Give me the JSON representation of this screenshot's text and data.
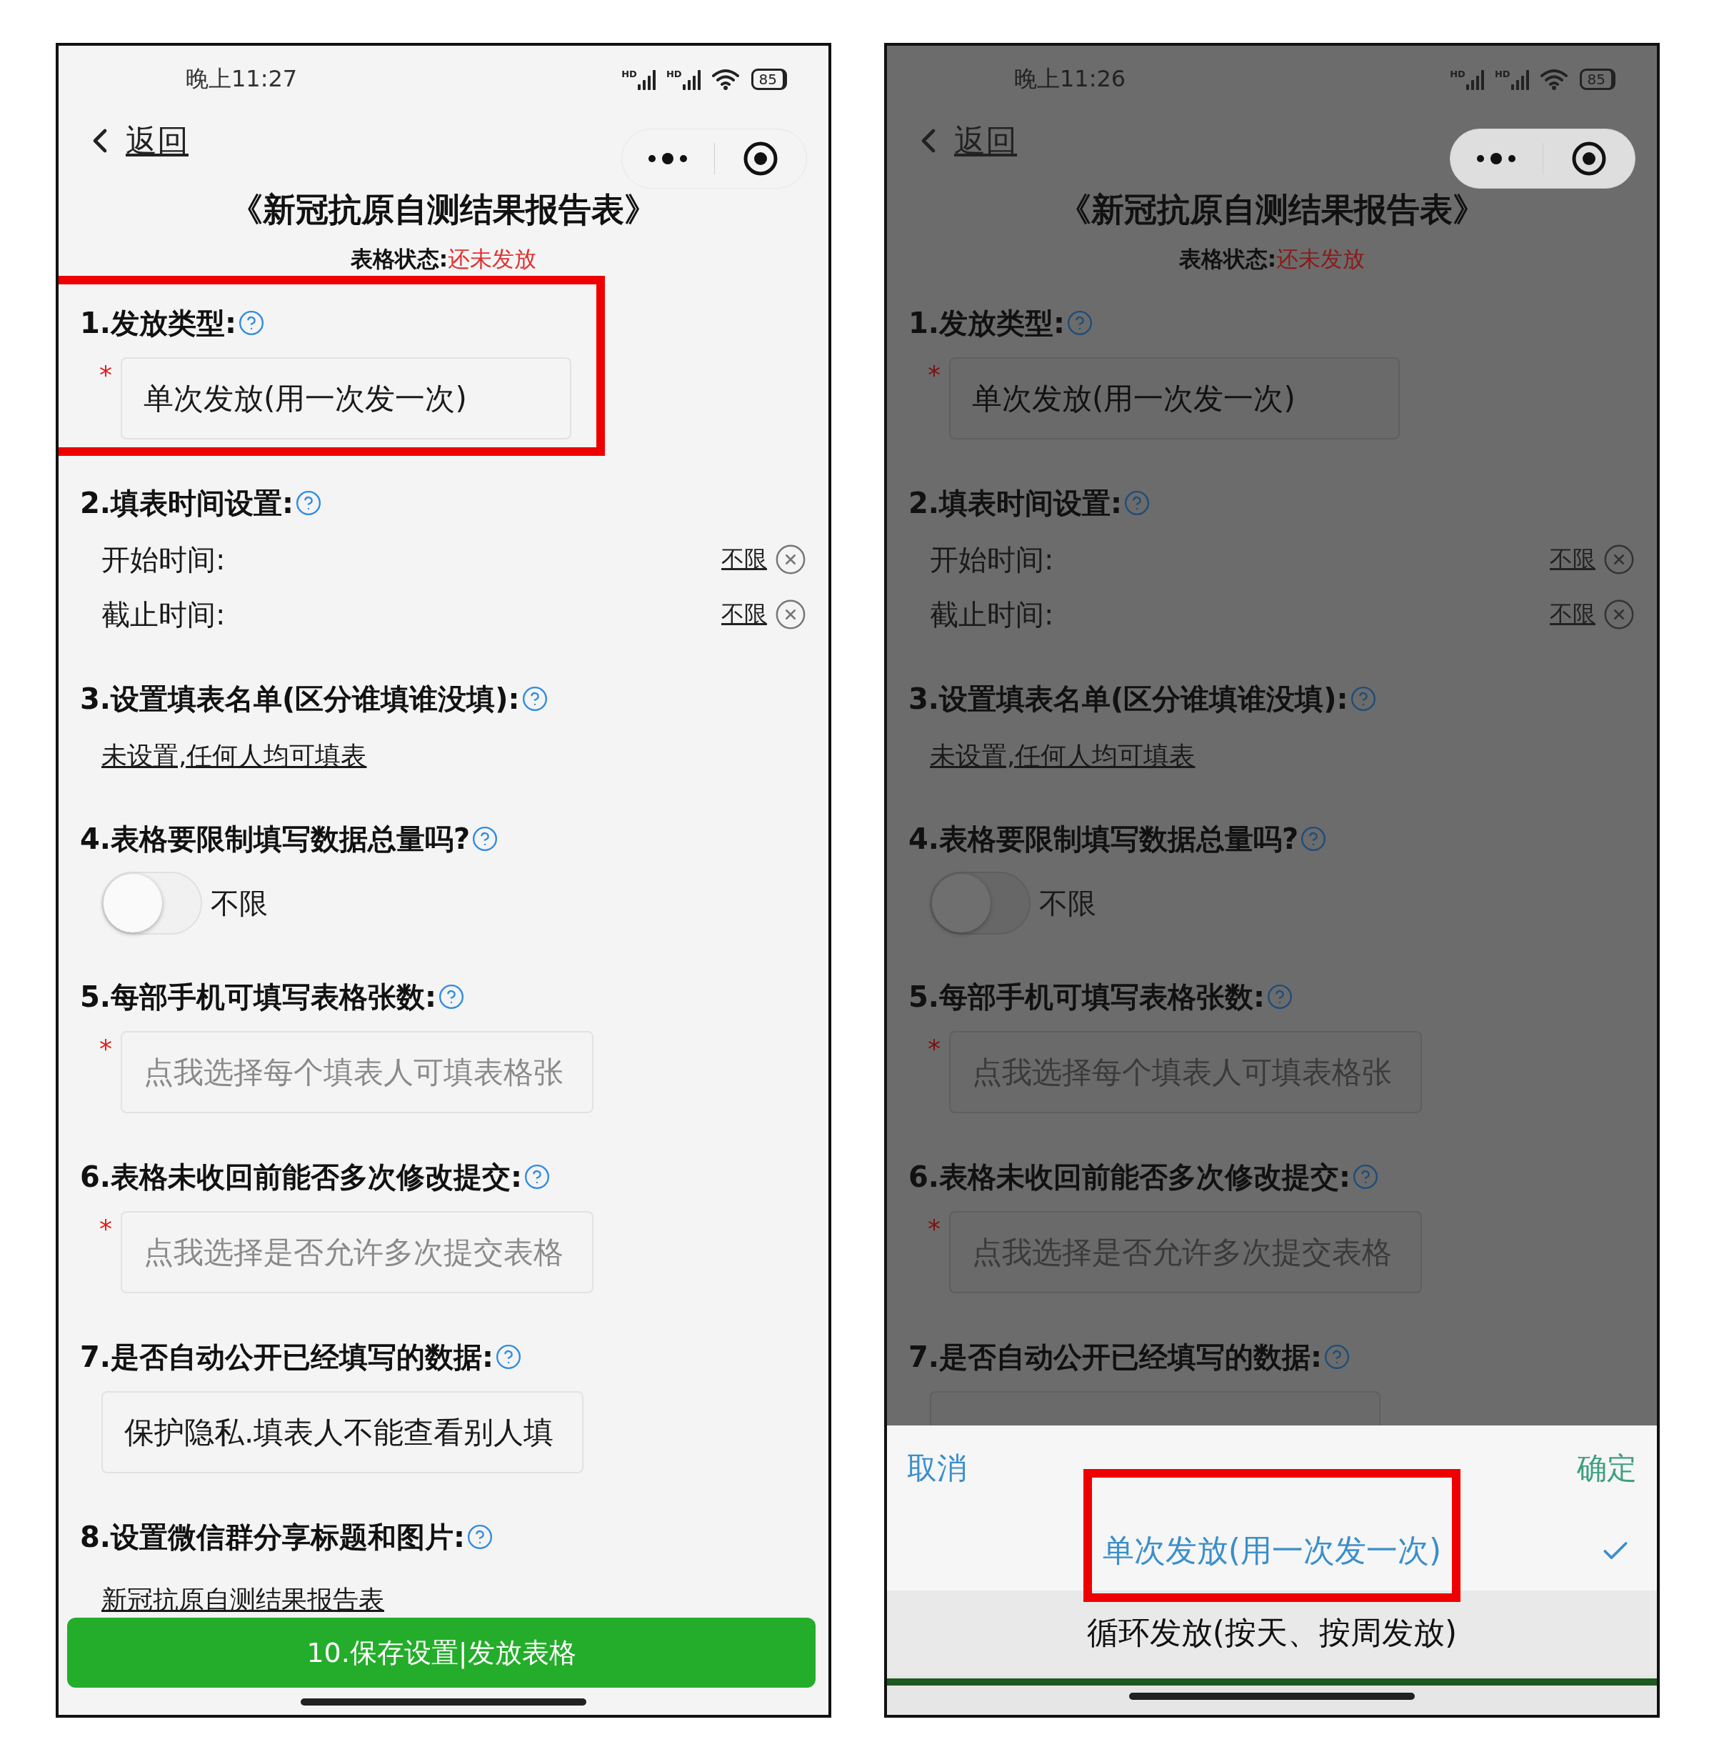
{
  "screens": [
    {
      "dimmed": false,
      "status_bar": {
        "time": "晚上11:27",
        "signal_labels": [
          "HD",
          "HD"
        ],
        "battery": "85"
      },
      "back": "返回",
      "title": "《新冠抗原自测结果报告表》",
      "form_status": {
        "label": "表格状态:",
        "value": "还未发放"
      },
      "sections": [
        {
          "kind": "select",
          "label": "1.发放类型:",
          "required_mark": "*",
          "value": "单次发放(用一次发一次)",
          "highlighted": true
        },
        {
          "kind": "time",
          "label": "2.填表时间设置:",
          "rows": [
            {
              "label": "开始时间:",
              "value": "不限"
            },
            {
              "label": "截止时间:",
              "value": "不限"
            }
          ]
        },
        {
          "kind": "link",
          "label": "3.设置填表名单(区分谁填谁没填):",
          "link": "未设置,任何人均可填表"
        },
        {
          "kind": "toggle",
          "label": "4.表格要限制填写数据总量吗?",
          "on": false,
          "text": "不限"
        },
        {
          "kind": "select",
          "label": "5.每部手机可填写表格张数:",
          "required_mark": "*",
          "placeholder": "点我选择每个填表人可填表格张"
        },
        {
          "kind": "select",
          "label": "6.表格未收回前能否多次修改提交:",
          "required_mark": "*",
          "placeholder": "点我选择是否允许多次提交表格"
        },
        {
          "kind": "select",
          "label": "7.是否自动公开已经填写的数据:",
          "value": "保护隐私.填表人不能查看别人填"
        },
        {
          "kind": "link",
          "label": "8.设置微信群分享标题和图片:",
          "link": "新冠抗原自测结果报告表"
        }
      ],
      "submit": "10.保存设置|发放表格"
    },
    {
      "dimmed": true,
      "status_bar": {
        "time": "晚上11:26",
        "signal_labels": [
          "HD",
          "HD"
        ],
        "battery": "85"
      },
      "back": "返回",
      "title": "《新冠抗原自测结果报告表》",
      "form_status": {
        "label": "表格状态:",
        "value": "还未发放"
      },
      "sections": [
        {
          "kind": "select",
          "label": "1.发放类型:",
          "required_mark": "*",
          "value": "单次发放(用一次发一次)"
        },
        {
          "kind": "time",
          "label": "2.填表时间设置:",
          "rows": [
            {
              "label": "开始时间:",
              "value": "不限"
            },
            {
              "label": "截止时间:",
              "value": "不限"
            }
          ]
        },
        {
          "kind": "link",
          "label": "3.设置填表名单(区分谁填谁没填):",
          "link": "未设置,任何人均可填表"
        },
        {
          "kind": "toggle",
          "label": "4.表格要限制填写数据总量吗?",
          "on": false,
          "text": "不限"
        },
        {
          "kind": "select",
          "label": "5.每部手机可填写表格张数:",
          "required_mark": "*",
          "placeholder": "点我选择每个填表人可填表格张"
        },
        {
          "kind": "select",
          "label": "6.表格未收回前能否多次修改提交:",
          "required_mark": "*",
          "placeholder": "点我选择是否允许多次提交表格"
        },
        {
          "kind": "select",
          "label": "7.是否自动公开已经填写的数据:"
        }
      ],
      "picker": {
        "cancel": "取消",
        "confirm": "确定",
        "options": [
          {
            "label": "单次发放(用一次发一次)",
            "selected": true,
            "highlighted": true
          },
          {
            "label": "循环发放(按天、按周发放)",
            "selected": false
          }
        ]
      }
    }
  ]
}
